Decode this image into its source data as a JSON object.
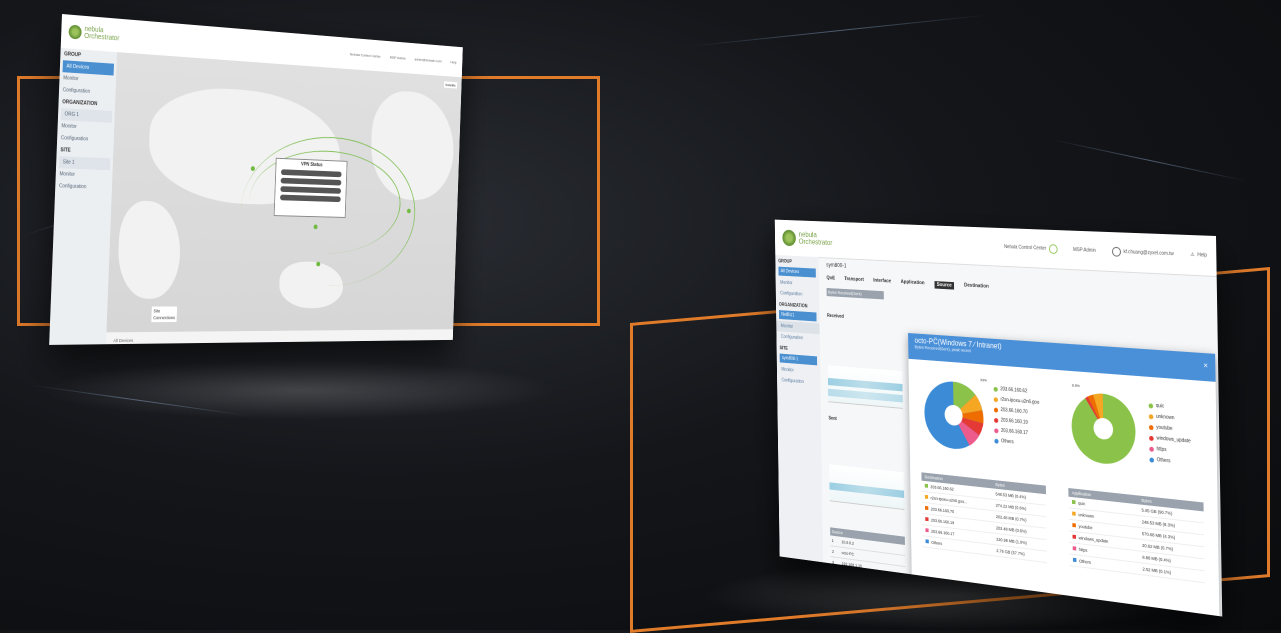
{
  "left_screen": {
    "logo_text_1": "nebula",
    "logo_text_2": "Orchestrator",
    "header_right": [
      "Nebula Control Center",
      "MSP Admin",
      "admin@domain.com",
      "Help"
    ],
    "sidebar": {
      "group_label": "GROUP",
      "group_select": "All Devices",
      "group_items": [
        "Monitor",
        "Configuration"
      ],
      "org_label": "ORGANIZATION",
      "org_select": "ORG 1",
      "org_items": [
        "Monitor",
        "Configuration"
      ],
      "site_label": "SITE",
      "site_select": "Site 1",
      "site_items": [
        "Monitor",
        "Configuration"
      ]
    },
    "popup_title": "VPN Status",
    "map_toggle": "Satellite",
    "bottom_bar": [
      "Site",
      "Connections"
    ],
    "footer": "All Devices"
  },
  "right_screen": {
    "logo_text_1": "nebula",
    "logo_text_2": "Orchestrator",
    "header": {
      "control_center": "Nebula Control Center",
      "msp_admin": "MSP Admin",
      "user": "kf.chuang@zyxel.com.tw",
      "help": "Help"
    },
    "sidebar": {
      "group_label": "GROUP",
      "group_select": "All Devices",
      "group_items": [
        "Monitor",
        "Configuration"
      ],
      "org_label": "ORGANIZATION",
      "org_select": "NetBiz1",
      "org_items": [
        "Monitor",
        "Configuration"
      ],
      "site_label": "SITE",
      "site_select": "sym800-1",
      "site_items": [
        "Monitor",
        "Configuration"
      ]
    },
    "breadcrumb": "sym800-1",
    "tabs": [
      "QoE",
      "Transport",
      "Interface",
      "Application",
      "Source",
      "Destination"
    ],
    "active_tab": "Source",
    "filter_select": "Bytes Received(Sent)",
    "left_charts": {
      "received_label": "Received",
      "sent_label": "Sent"
    },
    "mini_table": {
      "header": "Source",
      "rows": [
        [
          "1",
          "10.0.0.2"
        ],
        [
          "2",
          "octo-PC"
        ],
        [
          "3",
          "192.168.1.10"
        ]
      ]
    },
    "modal": {
      "title": "octo-PC̈(Windows 7 ∕ Intranet)",
      "subtitle": "Bytes Received(Sent), peak recent",
      "close": "×",
      "left_legend": [
        {
          "label": "203.66.160.62",
          "color": "#8bc34a"
        },
        {
          "label": "r2sn-ipoxu-u2n6.goo",
          "color": "#f5a623"
        },
        {
          "label": "203.66.160.70",
          "color": "#ef6c00"
        },
        {
          "label": "203.66.160.19",
          "color": "#e53935"
        },
        {
          "label": "203.66.160.17",
          "color": "#ec5b8c"
        },
        {
          "label": "Others",
          "color": "#3b8bd6"
        }
      ],
      "right_legend": [
        {
          "label": "quic",
          "color": "#8bc34a"
        },
        {
          "label": "unknown",
          "color": "#f5a623"
        },
        {
          "label": "youtube",
          "color": "#ef6c00"
        },
        {
          "label": "windows_update",
          "color": "#e53935"
        },
        {
          "label": "https",
          "color": "#ec5b8c"
        },
        {
          "label": "Others",
          "color": "#3b8bd6"
        }
      ],
      "left_pie_label": "33%",
      "right_pie_label": "8.6%",
      "left_table": {
        "headers": [
          "Destination",
          "Bytes"
        ],
        "rows": [
          [
            "203.66.160.62",
            "548.53 MB (0.4%)"
          ],
          [
            "r2sn-ipoxu-u2n6.goo...",
            "274.22 MB (0.6%)"
          ],
          [
            "203.66.160.70",
            "202.48 MB (0.7%)"
          ],
          [
            "203.66.160.19",
            "202.48 MB (0.6%)"
          ],
          [
            "203.66.160.17",
            "220.98 MB (1.0%)"
          ],
          [
            "Others",
            "2.76 GB (57.7%)"
          ]
        ]
      },
      "right_table": {
        "headers": [
          "Application",
          "Bytes"
        ],
        "rows": [
          [
            "quic",
            "5.85 GB (90.7%)"
          ],
          [
            "unknown",
            "248.53 MB (8.3%)"
          ],
          [
            "youtube",
            "570.68 MB (4.3%)"
          ],
          [
            "windows_update",
            "20.62 MB (0.7%)"
          ],
          [
            "https",
            "8.88 MB (0.4%)"
          ],
          [
            "Others",
            "2.62 MB (0.1%)"
          ]
        ]
      }
    }
  }
}
